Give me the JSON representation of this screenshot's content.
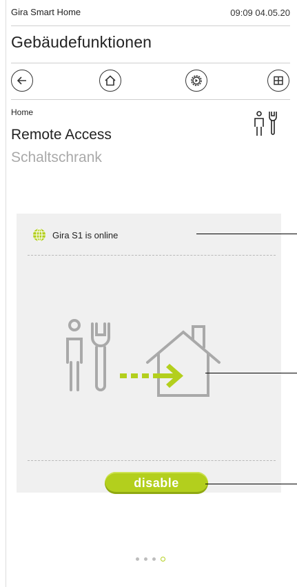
{
  "status_bar": {
    "app_name": "Gira Smart Home",
    "time": "09:09 04.05.20"
  },
  "page_title": "Gebäudefunktionen",
  "nav": [
    {
      "name": "back",
      "icon": "arrow-left-icon"
    },
    {
      "name": "home",
      "icon": "house-icon"
    },
    {
      "name": "settings",
      "icon": "gear-icon"
    },
    {
      "name": "grid",
      "icon": "grid-icon"
    }
  ],
  "breadcrumb": "Home",
  "heading": {
    "title": "Remote Access",
    "subtitle": "Schaltschrank"
  },
  "card": {
    "status_text": "Gira S1 is online",
    "status_icon": "globe-icon",
    "button_label": "disable",
    "accent_color": "#b3cf1d"
  },
  "pager": {
    "total": 4,
    "active": 4
  }
}
